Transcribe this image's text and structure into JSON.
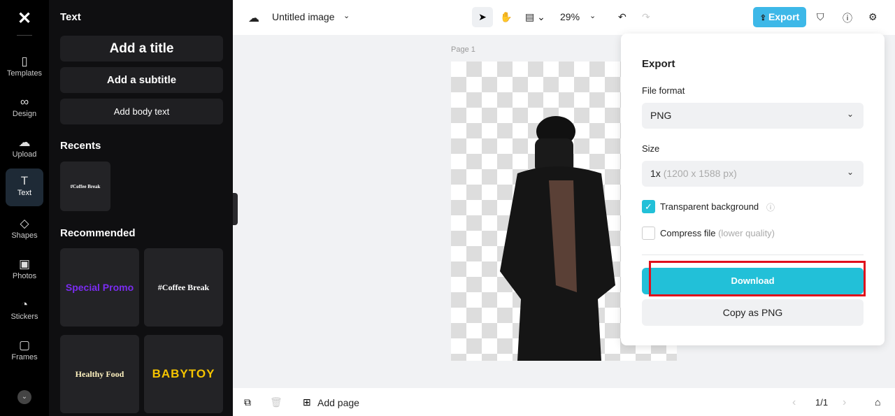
{
  "rail": {
    "items": [
      {
        "label": "Templates",
        "icon": "templates-icon"
      },
      {
        "label": "Design",
        "icon": "design-icon"
      },
      {
        "label": "Upload",
        "icon": "upload-icon"
      },
      {
        "label": "Text",
        "icon": "text-icon"
      },
      {
        "label": "Shapes",
        "icon": "shapes-icon"
      },
      {
        "label": "Photos",
        "icon": "photos-icon"
      },
      {
        "label": "Stickers",
        "icon": "stickers-icon"
      },
      {
        "label": "Frames",
        "icon": "frames-icon"
      }
    ],
    "active": "Text"
  },
  "panel": {
    "title": "Text",
    "add_title": "Add a title",
    "add_subtitle": "Add a subtitle",
    "add_body": "Add body text",
    "recents": "Recents",
    "recent_items": [
      "#Coffee Break"
    ],
    "recommended": "Recommended",
    "recommended_items": [
      "Special Promo",
      "#Coffee Break",
      "Healthy Food",
      "BABYTOY"
    ]
  },
  "topbar": {
    "doc_title": "Untitled image",
    "zoom": "29%",
    "export": "Export"
  },
  "canvas": {
    "page_label": "Page 1"
  },
  "export_panel": {
    "title": "Export",
    "file_format_label": "File format",
    "file_format": "PNG",
    "size_label": "Size",
    "size_value": "1x",
    "size_detail": "(1200 x 1588 px)",
    "transparent_bg": "Transparent background",
    "transparent_checked": true,
    "compress": "Compress file",
    "compress_note": "(lower quality)",
    "compress_checked": false,
    "download": "Download",
    "copy": "Copy as PNG",
    "accent": "#22c0d8",
    "highlight": "#e0101c"
  },
  "bottombar": {
    "add_page": "Add page",
    "page_count": "1/1"
  }
}
